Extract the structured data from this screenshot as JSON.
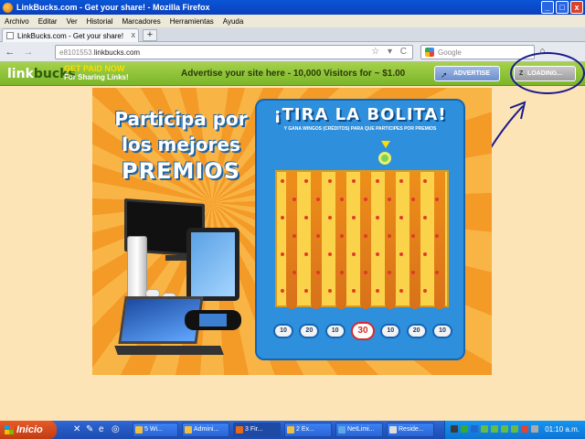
{
  "window": {
    "title": "LinkBucks.com - Get your share! - Mozilla Firefox",
    "controls": [
      "_",
      "□",
      "x"
    ]
  },
  "menubar": [
    "Archivo",
    "Editar",
    "Ver",
    "Historial",
    "Marcadores",
    "Herramientas",
    "Ayuda"
  ],
  "tab": {
    "title": "LinkBucks.com - Get your share!",
    "close": "x",
    "new_tab": "+"
  },
  "nav": {
    "back": "←",
    "forward": "→",
    "url_prefix": "e8101553.",
    "url_domain": "linkbucks.com",
    "url_buttons": "☆ ▾ C",
    "search_placeholder": "Google",
    "home": "⌂"
  },
  "linkbucks_bar": {
    "logo_link": "link",
    "logo_bucks": "bucks",
    "get_paid_line1": "GET PAID NOW",
    "get_paid_line2": "For Sharing Links!",
    "advert_text": "Advertise your site here - 10,000 Visitors for ~ $1.00",
    "advertise_button": "ADVERTISE",
    "loading_button": "LOADING...",
    "loading_icon": "Z"
  },
  "ad": {
    "headline_line1": "Participa por",
    "headline_line2": "los mejores",
    "headline_line3": "PREMIOS",
    "game_title": "¡TIRA LA BOLITA!",
    "game_subtitle": "Y GANA WINGOS (CRÉDITOS) PARA QUE PARTICIPES POR PREMIOS",
    "slots": [
      "10",
      "20",
      "10",
      "30",
      "10",
      "20",
      "10"
    ]
  },
  "taskbar": {
    "start": "Inicio",
    "tasks": [
      "5 Wi...",
      "Admini...",
      "3 Fir...",
      "2 Ex...",
      "NetLimi...",
      "Reside..."
    ],
    "clock": "01:10 a.m."
  },
  "colors": {
    "titlebar": "#0a56d6",
    "linkbucks_green": "#8cc43a",
    "page_background": "#fde4b6",
    "annotation": "#1a1a8c"
  }
}
